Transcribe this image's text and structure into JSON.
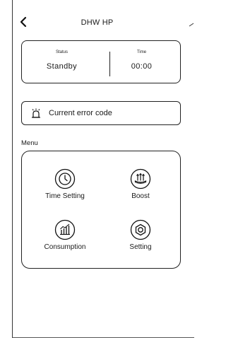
{
  "header": {
    "title": "DHW HP"
  },
  "status_card": {
    "status_label": "Status",
    "status_value": "Standby",
    "time_label": "Time",
    "time_value": "00:00"
  },
  "error": {
    "label": "Current error code"
  },
  "menu": {
    "heading": "Menu",
    "items": [
      {
        "label": "Time Setting",
        "icon": "clock-icon"
      },
      {
        "label": "Boost",
        "icon": "boost-icon"
      },
      {
        "label": "Consumption",
        "icon": "consumption-chart-icon"
      },
      {
        "label": "Setting",
        "icon": "settings-nut-icon"
      }
    ]
  }
}
